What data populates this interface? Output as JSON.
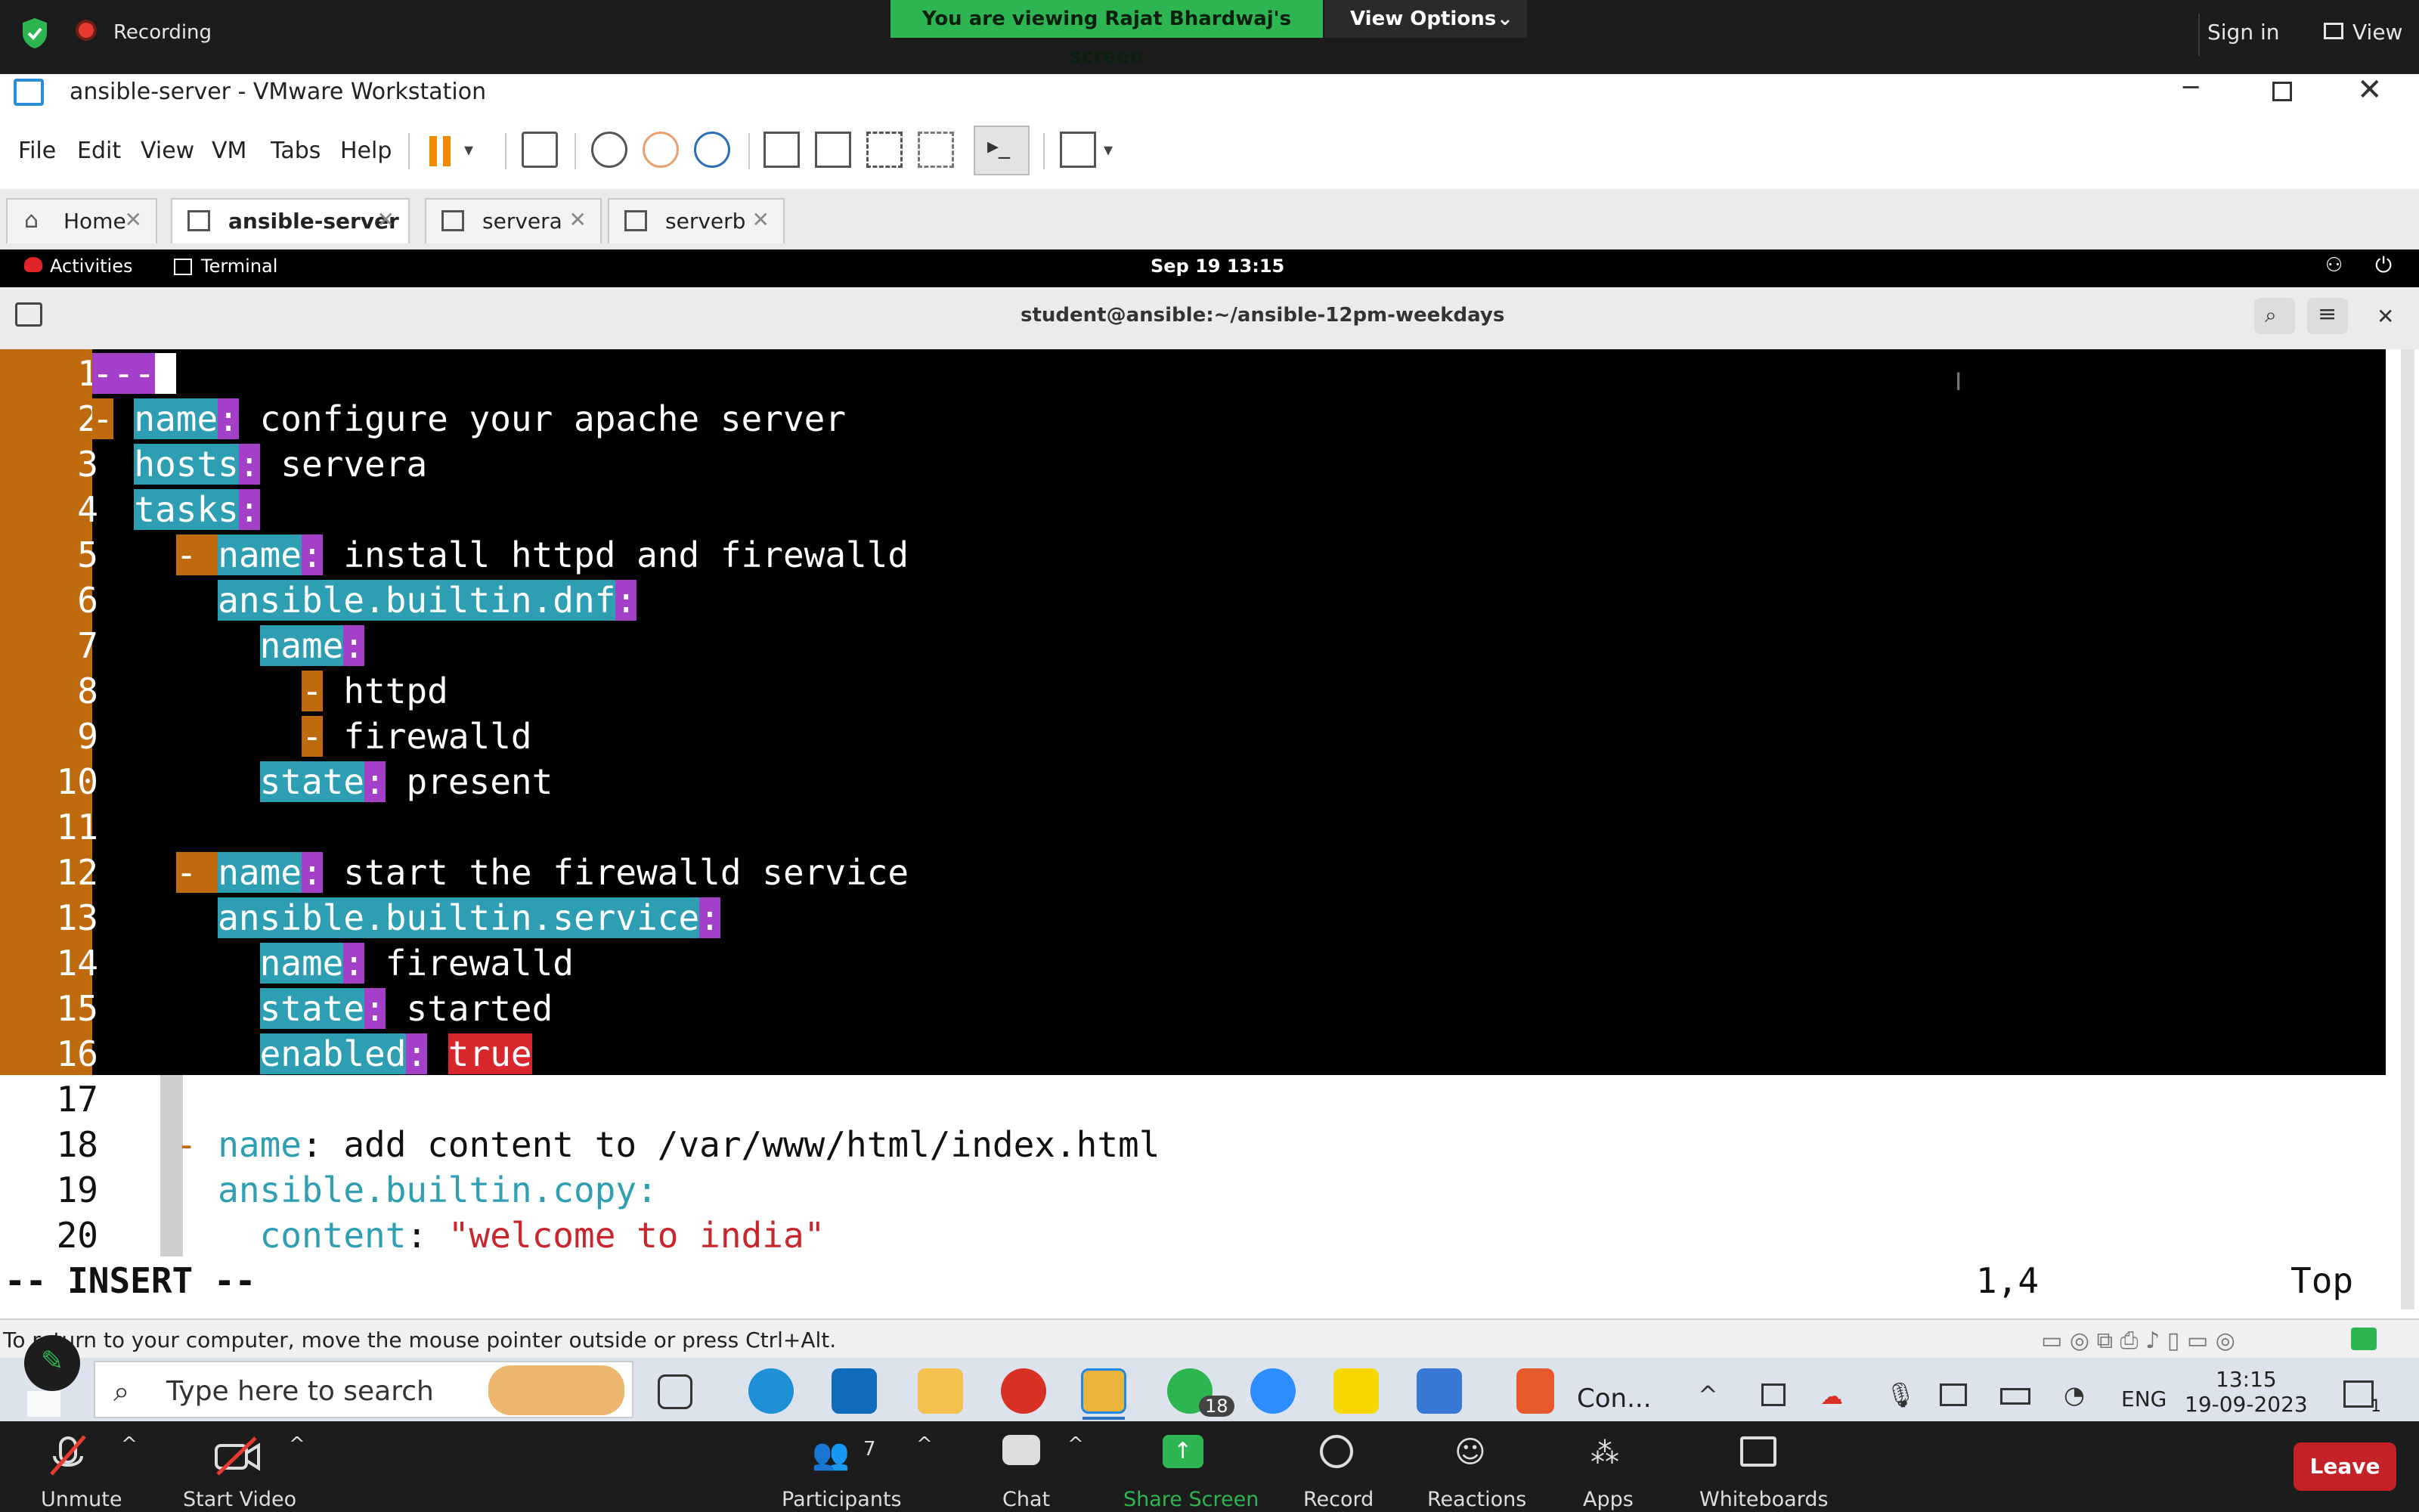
{
  "zoom_top": {
    "recording_label": "Recording",
    "viewing_banner": "You are viewing Rajat Bhardwaj's screen",
    "view_options_label": "View Options",
    "sign_in_label": "Sign in",
    "view_label": "View"
  },
  "vmware": {
    "window_title": "ansible-server - VMware Workstation",
    "menu": [
      "File",
      "Edit",
      "View",
      "VM",
      "Tabs",
      "Help"
    ],
    "tabs": [
      {
        "label": "Home",
        "active": false
      },
      {
        "label": "ansible-server",
        "active": true
      },
      {
        "label": "servera",
        "active": false
      },
      {
        "label": "serverb",
        "active": false
      }
    ],
    "status_text": "To return to your computer, move the mouse pointer outside or press Ctrl+Alt."
  },
  "gnome": {
    "activities": "Activities",
    "terminal": "Terminal",
    "datetime": "Sep 19  13:15"
  },
  "terminal": {
    "title": "student@ansible:~/ansible-12pm-weekdays"
  },
  "editor": {
    "line_numbers": [
      "1",
      "2",
      "3",
      "4",
      "5",
      "6",
      "7",
      "8",
      "9",
      "10",
      "11",
      "12",
      "13",
      "14",
      "15",
      "16",
      "17",
      "18",
      "19",
      "20"
    ],
    "lines": {
      "l1": "---",
      "l2_dash": "-",
      "l2_key": "name",
      "l2_val": " configure your apache server",
      "l3_key": "hosts",
      "l3_val": " servera",
      "l4_key": "tasks",
      "l5_dash": "-",
      "l5_key": "name",
      "l5_val": " install httpd and firewalld",
      "l6_key": "ansible.builtin.dnf",
      "l7_key": "name",
      "l8_dash": "-",
      "l8_val": " httpd",
      "l9_dash": "-",
      "l9_val": " firewalld",
      "l10_key": "state",
      "l10_val": " present",
      "l12_dash": "-",
      "l12_key": "name",
      "l12_val": " start the firewalld service",
      "l13_key": "ansible.builtin.service",
      "l14_key": "name",
      "l14_val": " firewalld",
      "l15_key": "state",
      "l15_val": " started",
      "l16_key": "enabled",
      "l16_val": "true",
      "l18_dash": "-",
      "l18_key": "name",
      "l18_val": " add content to /var/www/html/index.html",
      "l19_key": "ansible.builtin.copy",
      "l20_key": "content",
      "l20_val": "\"welcome to india\""
    },
    "mode": "-- INSERT --",
    "cursor_pos": "1,4",
    "scroll_pos": "Top"
  },
  "taskbar": {
    "search_placeholder": "Type here to search",
    "running_app_label": "Con...",
    "whatsapp_badge": "18",
    "language": "ENG",
    "time": "13:15",
    "date": "19-09-2023",
    "notification_count": "1"
  },
  "zoom_bottom": {
    "unmute": "Unmute",
    "start_video": "Start Video",
    "participants": "Participants",
    "participants_count": "7",
    "chat": "Chat",
    "share_screen": "Share Screen",
    "record": "Record",
    "reactions": "Reactions",
    "apps": "Apps",
    "whiteboards": "Whiteboards",
    "leave": "Leave"
  },
  "colors": {
    "zoom_green": "#2db551",
    "yaml_key_bg": "#2e9fb3",
    "yaml_colon_bg": "#a33fc9",
    "yaml_dash_bg": "#c06a0e",
    "yaml_true_bg": "#d8262d",
    "leave_red": "#c52228"
  }
}
